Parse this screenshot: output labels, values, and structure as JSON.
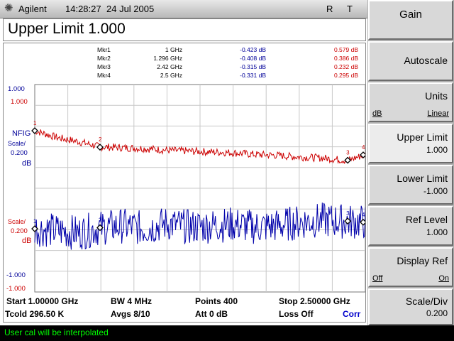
{
  "header": {
    "brand": "Agilent",
    "time": "14:28:27",
    "date": "24 Jul 2005",
    "flag_r": "R",
    "flag_t": "T"
  },
  "title": "Upper Limit 1.000",
  "markers": [
    {
      "name": "Mkr1",
      "freq": "1 GHz",
      "val1": "-0.423 dB",
      "val2": "0.579 dB"
    },
    {
      "name": "Mkr2",
      "freq": "1.296 GHz",
      "val1": "-0.408 dB",
      "val2": "0.386 dB"
    },
    {
      "name": "Mkr3",
      "freq": "2.42 GHz",
      "val1": "-0.315 dB",
      "val2": "0.232 dB"
    },
    {
      "name": "Mkr4",
      "freq": "2.5 GHz",
      "val1": "-0.331 dB",
      "val2": "0.295 dB"
    }
  ],
  "left_labels": {
    "top_scale_1": "1.000",
    "top_scale_2": "1.000",
    "nfig": "NFIG",
    "scale": "Scale/",
    "scale_val": "0.200",
    "unit": "dB",
    "scale2": "Scale/",
    "scale2_val": "0.200",
    "unit2": "dB",
    "bottom_scale_1": "-1.000",
    "bottom_scale_2": "-1.000"
  },
  "bottom_info": {
    "start": "Start 1.00000 GHz",
    "bw": "BW 4 MHz",
    "points": "Points 400",
    "stop": "Stop 2.50000 GHz",
    "tcold": "Tcold 296.50 K",
    "avgs": "Avgs 8/10",
    "att": "Att 0 dB",
    "loss": "Loss Off",
    "corr": "Corr"
  },
  "softkeys": [
    {
      "main": "Gain"
    },
    {
      "main": "Autoscale"
    },
    {
      "main": "Units",
      "opt1": "dB",
      "opt2": "Linear"
    },
    {
      "main": "Upper Limit",
      "sub": "1.000"
    },
    {
      "main": "Lower Limit",
      "sub": "-1.000"
    },
    {
      "main": "Ref Level",
      "sub": "1.000"
    },
    {
      "main": "Display Ref",
      "opt1": "Off",
      "opt2": "On"
    },
    {
      "main": "Scale/Div",
      "sub": "0.200"
    }
  ],
  "status": "User cal will be interpolated",
  "colors": {
    "upper_trace": "#cc0000",
    "lower_trace": "#0000aa",
    "grid": "#c8c8c8",
    "status_text": "#00ff00",
    "label_blue": "#000099",
    "label_red": "#cc0000"
  },
  "chart_data": {
    "type": "line",
    "x_range_ghz": [
      1.0,
      2.5
    ],
    "points": 400,
    "grid": true,
    "series": [
      {
        "name": "NFIG",
        "color": "#cc0000",
        "ylim": [
          -1.0,
          1.0
        ],
        "x": [
          1.0,
          1.1,
          1.2,
          1.296,
          1.4,
          1.5,
          1.6,
          1.7,
          1.8,
          1.9,
          2.0,
          2.1,
          2.2,
          2.3,
          2.42,
          2.5
        ],
        "y": [
          0.58,
          0.5,
          0.45,
          0.39,
          0.38,
          0.37,
          0.35,
          0.34,
          0.33,
          0.32,
          0.3,
          0.29,
          0.27,
          0.26,
          0.23,
          0.3
        ]
      },
      {
        "name": "",
        "color": "#0000aa",
        "ylim": [
          -1.0,
          1.0
        ],
        "x": [
          1.0,
          1.1,
          1.2,
          1.296,
          1.4,
          1.5,
          1.6,
          1.7,
          1.8,
          1.9,
          2.0,
          2.1,
          2.2,
          2.3,
          2.42,
          2.5
        ],
        "y": [
          -0.42,
          -0.45,
          -0.48,
          -0.41,
          -0.38,
          -0.42,
          -0.35,
          -0.4,
          -0.38,
          -0.36,
          -0.4,
          -0.38,
          -0.33,
          -0.3,
          -0.32,
          -0.33
        ]
      }
    ],
    "markers": [
      {
        "label": "1",
        "x": 1.0,
        "y_upper": 0.579,
        "y_lower": -0.423
      },
      {
        "label": "2",
        "x": 1.296,
        "y_upper": 0.386,
        "y_lower": -0.408
      },
      {
        "label": "3",
        "x": 2.42,
        "y_upper": 0.232,
        "y_lower": -0.315
      },
      {
        "label": "4",
        "x": 2.5,
        "y_upper": 0.295,
        "y_lower": -0.331
      }
    ]
  }
}
